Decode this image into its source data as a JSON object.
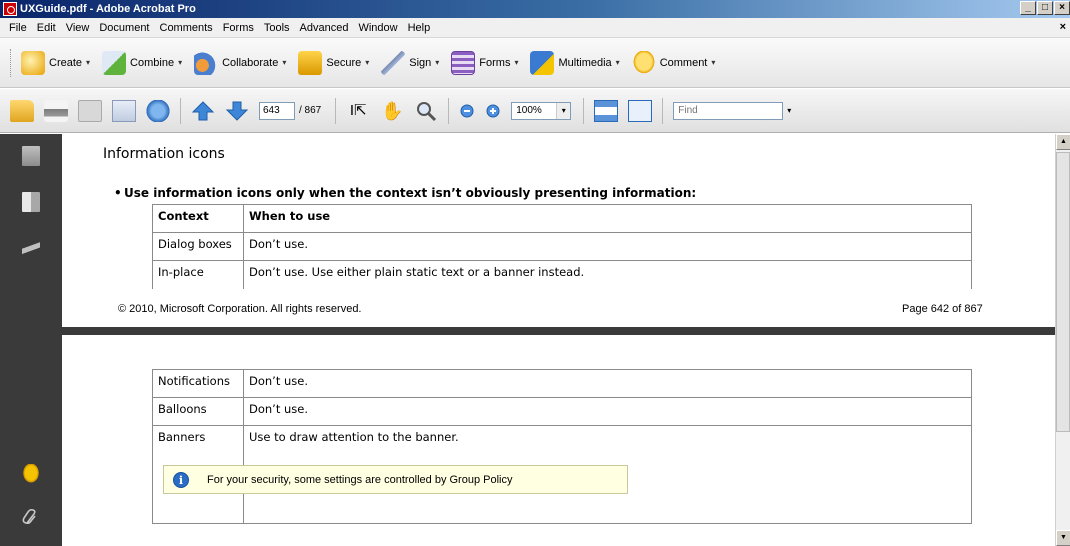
{
  "window": {
    "title": "UXGuide.pdf - Adobe Acrobat Pro",
    "controls": {
      "minimize": "_",
      "maximize": "□",
      "close": "×"
    }
  },
  "menubar": {
    "items": [
      "File",
      "Edit",
      "View",
      "Document",
      "Comments",
      "Forms",
      "Tools",
      "Advanced",
      "Window",
      "Help"
    ],
    "close": "×"
  },
  "tasks": [
    {
      "label": "Create",
      "icon": "create-icon"
    },
    {
      "label": "Combine",
      "icon": "combine-icon"
    },
    {
      "label": "Collaborate",
      "icon": "collaborate-icon"
    },
    {
      "label": "Secure",
      "icon": "lock-icon"
    },
    {
      "label": "Sign",
      "icon": "pen-icon"
    },
    {
      "label": "Forms",
      "icon": "form-icon"
    },
    {
      "label": "Multimedia",
      "icon": "multimedia-icon"
    },
    {
      "label": "Comment",
      "icon": "comment-icon"
    }
  ],
  "caret": "▾",
  "nav": {
    "page_current": "643",
    "page_total": "/ 867",
    "zoom": "100%",
    "find_placeholder": "Find"
  },
  "page1": {
    "section_title": "Information icons",
    "bullet": "Use information icons only when the context isn’t obviously presenting information:",
    "table": {
      "headers": [
        "Context",
        "When to use"
      ],
      "rows": [
        [
          "Dialog boxes",
          "Don’t use."
        ],
        [
          "In-place",
          "Don’t use. Use either plain static text or a banner instead."
        ]
      ]
    },
    "footer_left": "© 2010, Microsoft Corporation. All rights reserved.",
    "footer_right": "Page 642 of 867"
  },
  "page2": {
    "rows": [
      [
        "Notifications",
        "Don’t use."
      ],
      [
        "Balloons",
        "Don’t use."
      ],
      [
        "Banners",
        "Use to draw attention to the banner."
      ]
    ],
    "info_banner": "For your security, some settings are controlled by Group Policy"
  },
  "colors": {
    "title_gradient_start": "#0a246a",
    "left_panel": "#3a3a3a",
    "info_bg": "#ffffe1"
  }
}
